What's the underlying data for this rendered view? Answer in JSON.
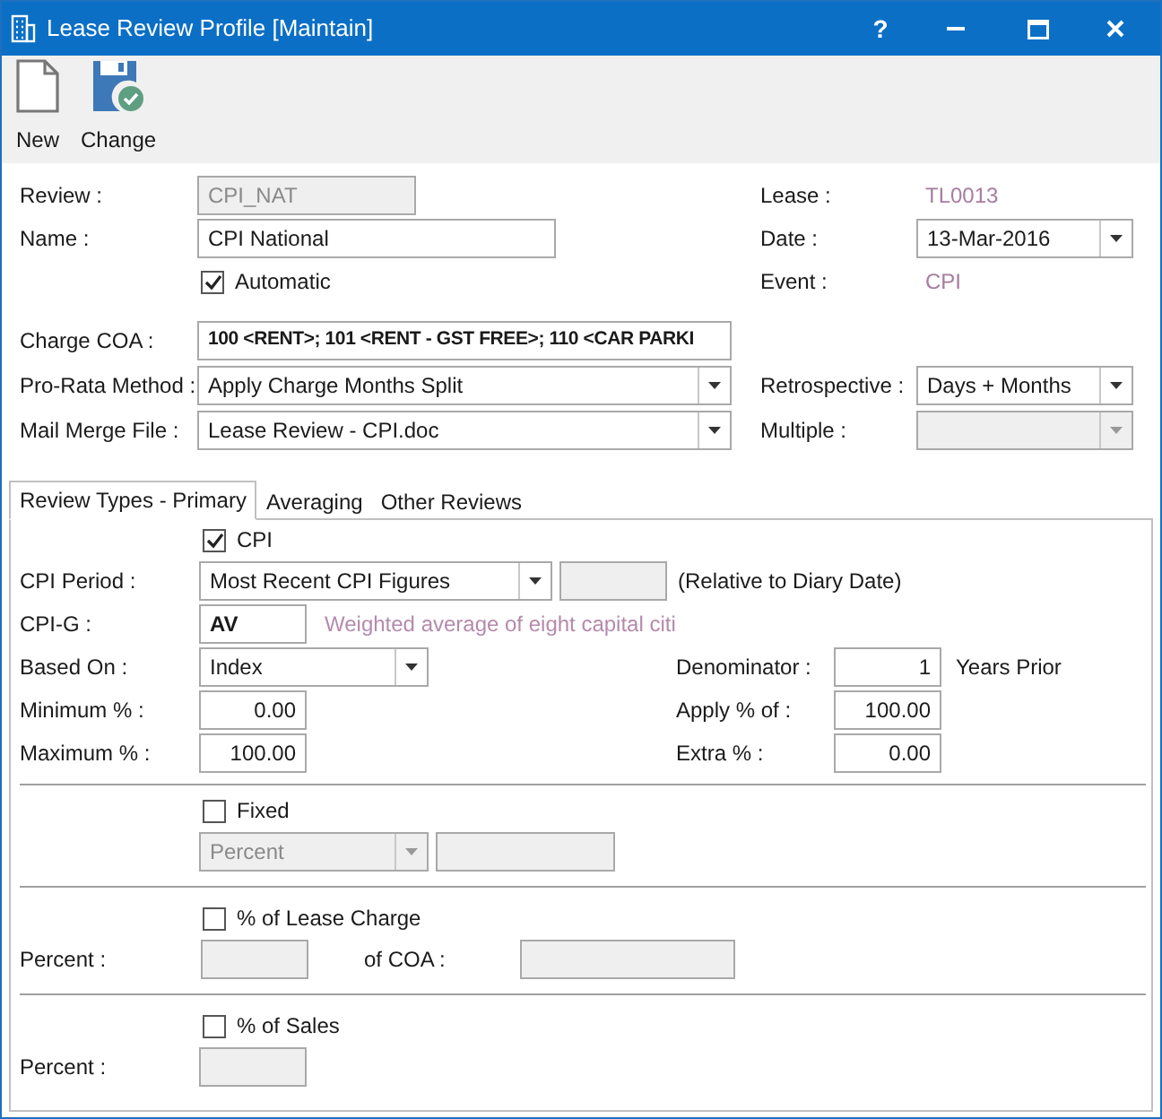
{
  "window": {
    "title": "Lease Review Profile [Maintain]",
    "help": "?"
  },
  "toolbar": [
    {
      "label": "New",
      "kind": "new"
    },
    {
      "label": "Change",
      "kind": "save"
    }
  ],
  "review": {
    "label": "Review :",
    "value": "CPI_NAT",
    "disabled": true
  },
  "lease": {
    "label": "Lease :",
    "value": "TL0013"
  },
  "name": {
    "label": "Name :",
    "value": "CPI National"
  },
  "date": {
    "label": "Date :",
    "value": "13-Mar-2016"
  },
  "automatic": {
    "label": "Automatic",
    "checked": true
  },
  "event": {
    "label": "Event :",
    "value": "CPI"
  },
  "charge_coa": {
    "label": "Charge COA :",
    "value": "100 <RENT>; 101 <RENT - GST FREE>; 110 <CAR PARKI"
  },
  "pro_rata_method": {
    "label": "Pro-Rata Method :",
    "value": "Apply Charge Months Split"
  },
  "retrospective": {
    "label": "Retrospective :",
    "value": "Days + Months"
  },
  "mail_merge_file": {
    "label": "Mail Merge File :",
    "value": "Lease Review - CPI.doc"
  },
  "multiple": {
    "label": "Multiple :",
    "disabled": true
  },
  "tabs": [
    {
      "label": "Review Types - Primary",
      "selected": true
    },
    {
      "label": "Averaging",
      "selected": false
    },
    {
      "label": "Other Reviews",
      "selected": false
    }
  ],
  "cpi": {
    "label": "CPI",
    "checked": true
  },
  "cpi_period": {
    "label": "CPI Period :",
    "value": "Most Recent CPI Figures",
    "note": "(Relative to Diary Date)"
  },
  "cpi_g": {
    "label": "CPI-G :",
    "value": "AV",
    "description": "Weighted average of eight capital citi"
  },
  "based_on": {
    "label": "Based On :",
    "value": "Index"
  },
  "denominator": {
    "label": "Denominator :",
    "value": "1",
    "unit": "Years Prior"
  },
  "minimum": {
    "label": "Minimum % :",
    "value": "0.00"
  },
  "apply_pct": {
    "label": "Apply % of :",
    "value": "100.00"
  },
  "maximum": {
    "label": "Maximum % :",
    "value": "100.00"
  },
  "extra": {
    "label": "Extra % :",
    "value": "0.00"
  },
  "fixed": {
    "label": "Fixed",
    "checked": false,
    "type_value": "Percent",
    "disabled": true
  },
  "lease_charge": {
    "label": "% of Lease Charge",
    "checked": false,
    "percent_label": "Percent :",
    "coa_label": "of COA :"
  },
  "sales": {
    "label": "% of Sales",
    "checked": false,
    "percent_label": "Percent :"
  }
}
